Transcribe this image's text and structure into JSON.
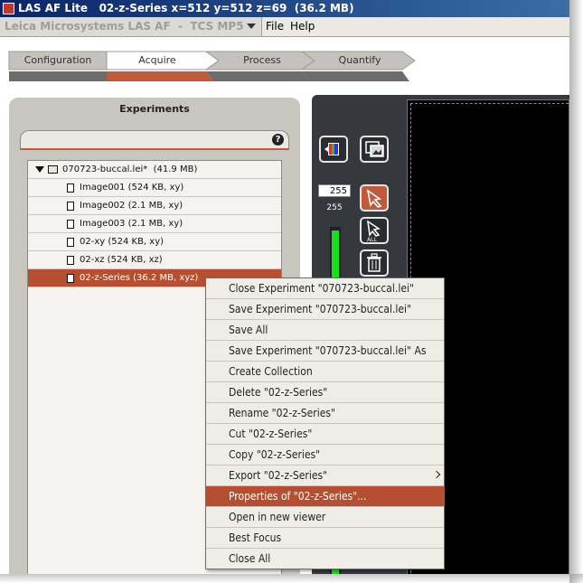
{
  "window": {
    "title": "LAS AF Lite   02-z-Series x=512 y=512 z=69  (36.2 MB)"
  },
  "menubar": {
    "product_label": "Leica Microsystems LAS AF  -  TCS MP5",
    "items": [
      "File",
      "Help"
    ]
  },
  "workflow_tabs": [
    {
      "label": "Configuration",
      "active": false
    },
    {
      "label": "Acquire",
      "active": true
    },
    {
      "label": "Process",
      "active": false
    },
    {
      "label": "Quantify",
      "active": false
    }
  ],
  "experiments_panel": {
    "title": "Experiments",
    "help_glyph": "?",
    "tree": [
      {
        "label": "070723-buccal.lei*  (41.9 MB)",
        "type": "experiment",
        "expanded": true
      },
      {
        "label": "Image001 (524 KB, xy)",
        "type": "image"
      },
      {
        "label": "Image002 (2.1 MB, xy)",
        "type": "image"
      },
      {
        "label": "Image003 (2.1 MB, xy)",
        "type": "image"
      },
      {
        "label": "02-xy (524 KB, xy)",
        "type": "image"
      },
      {
        "label": "02-xz (524 KB, xz)",
        "type": "image"
      },
      {
        "label": "02-z-Series (36.2 MB, xyz)",
        "type": "image",
        "selected": true
      }
    ]
  },
  "viewer": {
    "intensity_value": "255",
    "intensity_label": "255",
    "tools": [
      "color-lut-icon",
      "overlay-toggle-icon",
      "draw-roi-icon",
      "select-all-roi-icon",
      "delete-roi-icon"
    ]
  },
  "context_menu": {
    "items": [
      {
        "label": "Close Experiment \"070723-buccal.lei\""
      },
      {
        "label": "Save Experiment \"070723-buccal.lei\""
      },
      {
        "label": "Save All"
      },
      {
        "label": "Save Experiment \"070723-buccal.lei\" As"
      },
      {
        "label": "Create Collection"
      },
      {
        "label": "Delete \"02-z-Series\""
      },
      {
        "label": "Rename \"02-z-Series\""
      },
      {
        "label": "Cut \"02-z-Series\""
      },
      {
        "label": "Copy \"02-z-Series\""
      },
      {
        "label": "Export \"02-z-Series\"",
        "submenu": true
      },
      {
        "label": "Properties of \"02-z-Series\"...",
        "highlighted": true
      },
      {
        "label": "Open in new viewer"
      },
      {
        "label": "Best Focus"
      },
      {
        "label": "Close All"
      }
    ]
  },
  "colors": {
    "accent": "#b64f31",
    "panel": "#c9c6bf",
    "viewer_bg": "#35393d",
    "lut_green": "#19e01a"
  }
}
